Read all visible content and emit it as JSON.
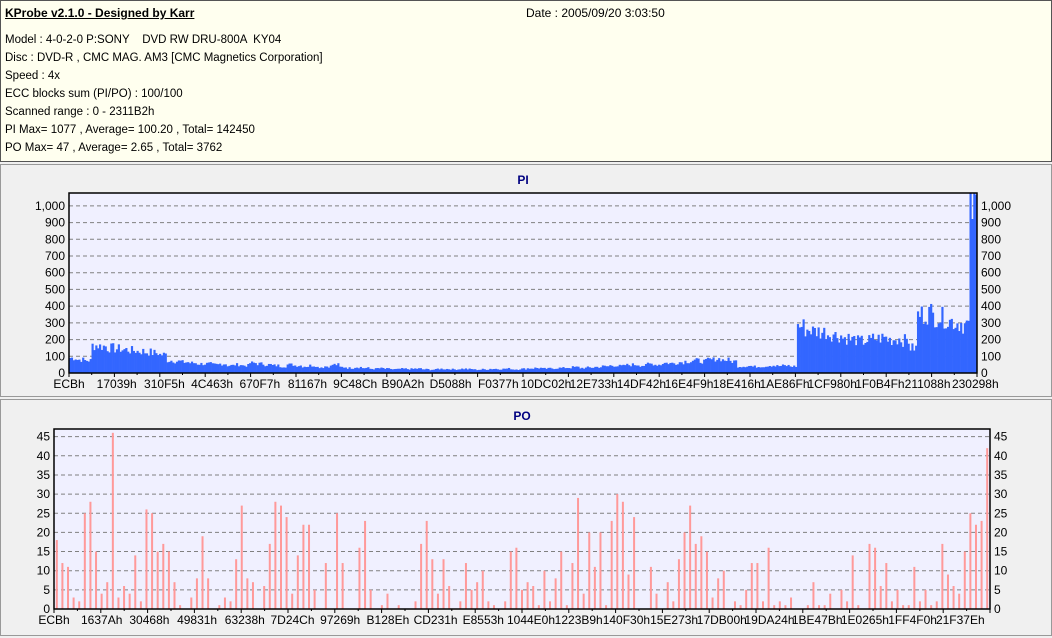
{
  "header": {
    "title": "KProbe v2.1.0 - Designed by Karr",
    "date": "Date : 2005/09/20 3:03:50",
    "lines": [
      "Model : 4-0-2-0 P:SONY    DVD RW DRU-800A  KY04",
      "Disc : DVD-R , CMC MAG. AM3 [CMC Magnetics Corporation]",
      "Speed : 4x",
      "ECC blocks sum (PI/PO) : 100/100",
      "Scanned range : 0 - 2311B2h",
      "PI Max= 1077 , Average= 100.20 , Total= 142450",
      "PO Max= 47 , Average= 2.65 , Total= 3762"
    ]
  },
  "colors": {
    "pi": "#3366ff",
    "po": "#ff9999",
    "plot_bg": "#f0f0ff",
    "title": "#000080"
  },
  "chart_data": [
    {
      "type": "bar",
      "title": "PI",
      "ylim": [
        0,
        1077
      ],
      "yticks": [
        0,
        100,
        200,
        300,
        400,
        500,
        600,
        700,
        800,
        900,
        1000
      ],
      "ytick_labels": [
        "0",
        "100",
        "200",
        "300",
        "400",
        "500",
        "600",
        "700",
        "800",
        "900",
        "1,000"
      ],
      "xtick_labels": [
        "ECBh",
        "17039h",
        "310F5h",
        "4C463h",
        "670F7h",
        "81167h",
        "9C48Ch",
        "B90A2h",
        "D5088h",
        "F0377h",
        "10DC02h",
        "12E733h",
        "14DF42h",
        "16E4F9h",
        "18E416h",
        "1AE86Fh",
        "1CF980h",
        "1F0B4Fh",
        "211088h",
        "230298h"
      ],
      "grid": true,
      "values": [
        90,
        80,
        75,
        165,
        160,
        150,
        145,
        140,
        135,
        130,
        125,
        120,
        110,
        75,
        70,
        65,
        60,
        55,
        55,
        50,
        55,
        45,
        50,
        45,
        60,
        55,
        50,
        45,
        40,
        50,
        45,
        40,
        45,
        35,
        40,
        50,
        35,
        30,
        35,
        30,
        25,
        28,
        25,
        22,
        25,
        24,
        26,
        22,
        20,
        25,
        24,
        22,
        25,
        23,
        20,
        22,
        25,
        24,
        26,
        22,
        25,
        28,
        30,
        26,
        28,
        30,
        32,
        35,
        30,
        33,
        36,
        40,
        45,
        42,
        48,
        50,
        45,
        55,
        50,
        60,
        58,
        65,
        70,
        75,
        70,
        80,
        85,
        78,
        70,
        40,
        42,
        38,
        40,
        45,
        42,
        44,
        40,
        280,
        260,
        250,
        245,
        235,
        225,
        210,
        200,
        190,
        195,
        205,
        210,
        200,
        205,
        195,
        150,
        350,
        360,
        340,
        330,
        310,
        300,
        290,
        1000
      ]
    },
    {
      "type": "bar",
      "title": "PO",
      "ylim": [
        0,
        47
      ],
      "yticks": [
        0,
        5,
        10,
        15,
        20,
        25,
        30,
        35,
        40,
        45
      ],
      "ytick_labels": [
        "0",
        "5",
        "10",
        "15",
        "20",
        "25",
        "30",
        "35",
        "40",
        "45"
      ],
      "xtick_labels": [
        "ECBh",
        "1637Ah",
        "30468h",
        "49831h",
        "63238h",
        "7D24Ch",
        "97269h",
        "B128Eh",
        "CD231h",
        "E8553h",
        "1044E0h",
        "1223B9h",
        "140F30h",
        "15E273h",
        "17DB00h",
        "19DA24h",
        "1BE47Bh",
        "1E0265h",
        "1FF4F0h",
        "21F37Eh"
      ],
      "grid": true,
      "values": [
        18,
        12,
        11,
        3,
        2,
        25,
        28,
        15,
        4,
        7,
        46,
        3,
        6,
        4,
        14,
        2,
        26,
        25,
        15,
        17,
        15,
        7,
        1,
        0,
        3,
        8,
        19,
        8,
        0,
        1,
        3,
        2,
        13,
        27,
        8,
        7,
        0,
        6,
        17,
        28,
        27,
        24,
        4,
        14,
        22,
        22,
        5,
        0,
        12,
        0,
        25,
        12,
        0,
        0,
        16,
        23,
        5,
        0,
        1,
        4,
        0,
        1,
        0,
        0,
        2,
        17,
        23,
        13,
        4,
        13,
        6,
        0,
        2,
        12,
        5,
        7,
        10,
        2,
        1,
        0,
        2,
        15,
        16,
        5,
        7,
        6,
        1,
        10,
        2,
        8,
        15,
        1,
        12,
        29,
        4,
        20,
        11,
        20,
        1,
        23,
        30,
        28,
        9,
        24,
        0,
        0,
        11,
        4,
        0,
        7,
        2,
        13,
        20,
        27,
        17,
        19,
        15,
        3,
        8,
        10,
        0,
        2,
        1,
        5,
        12,
        12,
        2,
        16,
        1,
        2,
        1,
        3,
        0,
        0,
        1,
        7,
        1,
        1,
        4,
        0,
        5,
        2,
        14,
        1,
        0,
        17,
        16,
        6,
        12,
        2,
        5,
        1,
        1,
        11,
        2,
        5,
        1,
        2,
        17,
        9,
        6,
        4,
        15,
        25,
        22,
        23,
        42
      ]
    }
  ]
}
